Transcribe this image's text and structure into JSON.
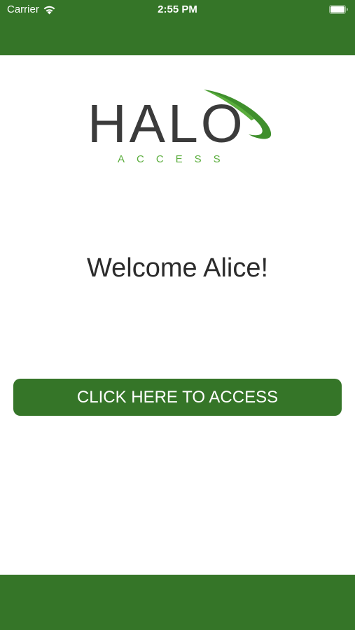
{
  "status_bar": {
    "carrier": "Carrier",
    "time": "2:55 PM",
    "wifi_icon": "wifi-icon",
    "battery_icon": "battery-icon"
  },
  "logo": {
    "wordmark": "HALO",
    "subtitle": "ACCESS",
    "ring_icon": "orbit-ring-icon"
  },
  "welcome": {
    "message": "Welcome Alice!"
  },
  "access_button": {
    "label": "CLICK HERE TO ACCESS"
  },
  "colors": {
    "brand_green": "#357528",
    "logo_green": "#5aad3c",
    "logo_gray": "#3b3b3b",
    "text_dark": "#2b2b2b",
    "background": "#ffffff"
  }
}
